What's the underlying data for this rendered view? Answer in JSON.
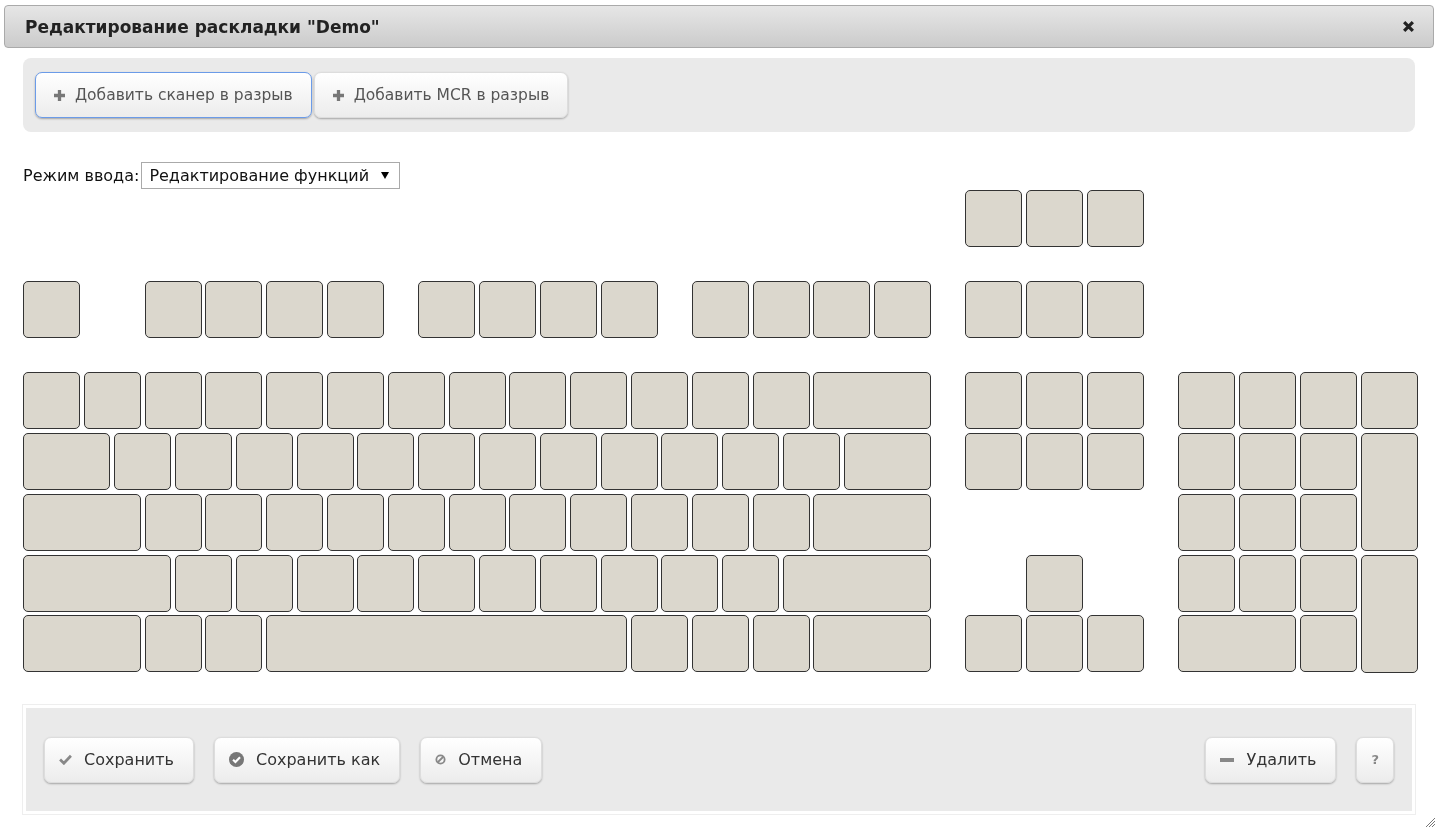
{
  "window": {
    "title": "Редактирование раскладки \"Demo\""
  },
  "toolbar": {
    "buttons": [
      {
        "label": "Добавить сканер в разрыв",
        "kind": "add",
        "focused": true
      },
      {
        "label": "Добавить MCR в разрыв",
        "kind": "add",
        "focused": false
      }
    ]
  },
  "input_mode": {
    "label": "Режим ввода:",
    "value": "Редактирование функций"
  },
  "footer": {
    "left_buttons": [
      {
        "label": "Сохранить",
        "kind": "save"
      },
      {
        "label": "Сохранить как",
        "kind": "save-as"
      },
      {
        "label": "Отмена",
        "kind": "cancel"
      }
    ],
    "right_buttons": [
      {
        "label": "Удалить",
        "kind": "delete"
      },
      {
        "label": "?",
        "kind": "help"
      }
    ]
  }
}
